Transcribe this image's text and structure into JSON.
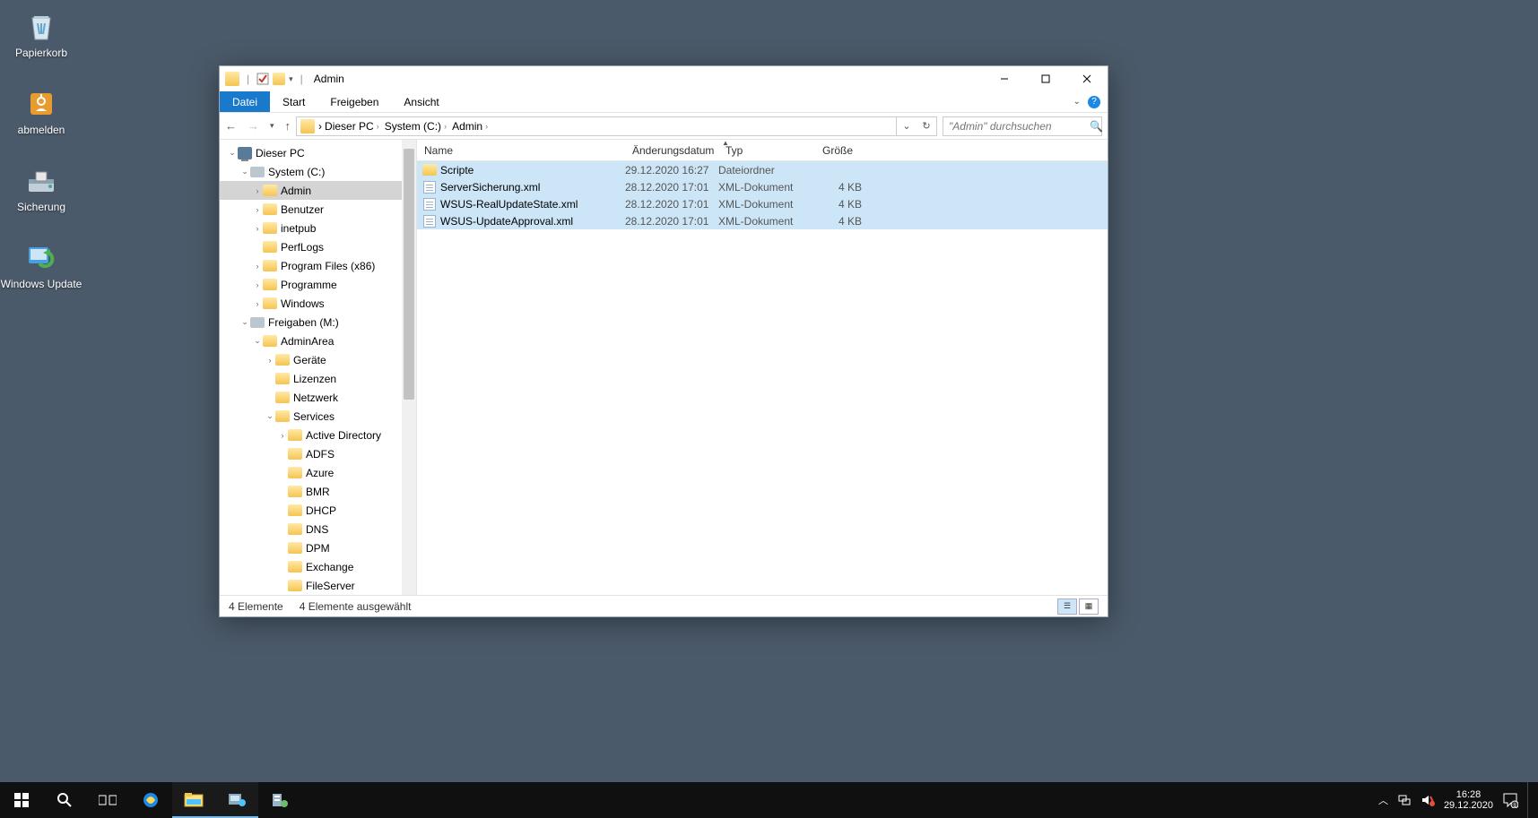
{
  "desktop": {
    "icons": [
      {
        "name": "Papierkorb",
        "icon": "recycle-bin"
      },
      {
        "name": "abmelden",
        "icon": "logoff"
      },
      {
        "name": "Sicherung",
        "icon": "backup"
      },
      {
        "name": "Windows Update",
        "icon": "windows-update"
      }
    ]
  },
  "explorer": {
    "title": "Admin",
    "ribbon": {
      "file": "Datei",
      "tabs": [
        "Start",
        "Freigeben",
        "Ansicht"
      ]
    },
    "breadcrumb": [
      "Dieser PC",
      "System (C:)",
      "Admin"
    ],
    "search_placeholder": "\"Admin\" durchsuchen",
    "columns": {
      "name": "Name",
      "date": "Änderungsdatum",
      "type": "Typ",
      "size": "Größe"
    },
    "tree": [
      {
        "label": "Dieser PC",
        "level": 0,
        "icon": "pc",
        "expanded": true
      },
      {
        "label": "System (C:)",
        "level": 1,
        "icon": "drive",
        "expanded": true
      },
      {
        "label": "Admin",
        "level": 2,
        "icon": "folder",
        "selected": true,
        "arrow": "closed"
      },
      {
        "label": "Benutzer",
        "level": 2,
        "icon": "folder",
        "arrow": "closed"
      },
      {
        "label": "inetpub",
        "level": 2,
        "icon": "folder",
        "arrow": "closed"
      },
      {
        "label": "PerfLogs",
        "level": 2,
        "icon": "folder"
      },
      {
        "label": "Program Files (x86)",
        "level": 2,
        "icon": "folder",
        "arrow": "closed"
      },
      {
        "label": "Programme",
        "level": 2,
        "icon": "folder",
        "arrow": "closed"
      },
      {
        "label": "Windows",
        "level": 2,
        "icon": "folder",
        "arrow": "closed"
      },
      {
        "label": "Freigaben (M:)",
        "level": 1,
        "icon": "drive",
        "expanded": true
      },
      {
        "label": "AdminArea",
        "level": 2,
        "icon": "folder-shared",
        "expanded": true
      },
      {
        "label": "Geräte",
        "level": 3,
        "icon": "folder",
        "arrow": "closed"
      },
      {
        "label": "Lizenzen",
        "level": 3,
        "icon": "folder"
      },
      {
        "label": "Netzwerk",
        "level": 3,
        "icon": "folder"
      },
      {
        "label": "Services",
        "level": 3,
        "icon": "folder",
        "expanded": true
      },
      {
        "label": "Active Directory",
        "level": 4,
        "icon": "folder",
        "arrow": "closed"
      },
      {
        "label": "ADFS",
        "level": 4,
        "icon": "folder"
      },
      {
        "label": "Azure",
        "level": 4,
        "icon": "folder"
      },
      {
        "label": "BMR",
        "level": 4,
        "icon": "folder"
      },
      {
        "label": "DHCP",
        "level": 4,
        "icon": "folder"
      },
      {
        "label": "DNS",
        "level": 4,
        "icon": "folder"
      },
      {
        "label": "DPM",
        "level": 4,
        "icon": "folder"
      },
      {
        "label": "Exchange",
        "level": 4,
        "icon": "folder"
      },
      {
        "label": "FileServer",
        "level": 4,
        "icon": "folder"
      }
    ],
    "files": [
      {
        "name": "Scripte",
        "date": "29.12.2020 16:27",
        "type": "Dateiordner",
        "size": "",
        "icon": "folder",
        "selected": true
      },
      {
        "name": "ServerSicherung.xml",
        "date": "28.12.2020 17:01",
        "type": "XML-Dokument",
        "size": "4 KB",
        "icon": "xml",
        "selected": true
      },
      {
        "name": "WSUS-RealUpdateState.xml",
        "date": "28.12.2020 17:01",
        "type": "XML-Dokument",
        "size": "4 KB",
        "icon": "xml",
        "selected": true
      },
      {
        "name": "WSUS-UpdateApproval.xml",
        "date": "28.12.2020 17:01",
        "type": "XML-Dokument",
        "size": "4 KB",
        "icon": "xml",
        "selected": true
      }
    ],
    "status": {
      "count": "4 Elemente",
      "selected": "4 Elemente ausgewählt"
    }
  },
  "taskbar": {
    "time": "16:28",
    "date": "29.12.2020"
  }
}
